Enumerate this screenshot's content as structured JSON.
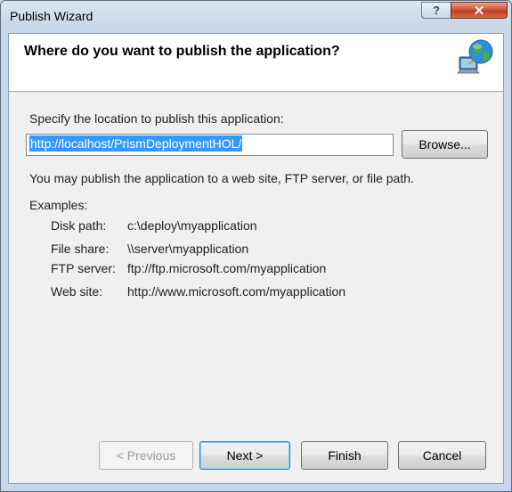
{
  "window": {
    "title": "Publish Wizard",
    "help_label": "?",
    "close_label": "✕"
  },
  "header": {
    "title": "Where do you want to publish the application?",
    "icon": "globe-network-icon"
  },
  "location": {
    "label": "Specify the location to publish this application:",
    "value": "http://localhost/PrismDeploymentHOL/",
    "browse_label": "Browse..."
  },
  "info_text": "You may publish the application to a web site, FTP server, or file path.",
  "examples": {
    "heading": "Examples:",
    "items": [
      {
        "label": "Disk path:",
        "value": "c:\\deploy\\myapplication"
      },
      {
        "label": "File share:",
        "value": "\\\\server\\myapplication"
      },
      {
        "label": "FTP server:",
        "value": "ftp://ftp.microsoft.com/myapplication"
      },
      {
        "label": "Web site:",
        "value": "http://www.microsoft.com/myapplication"
      }
    ]
  },
  "buttons": {
    "previous": "< Previous",
    "next": "Next >",
    "finish": "Finish",
    "cancel": "Cancel"
  }
}
